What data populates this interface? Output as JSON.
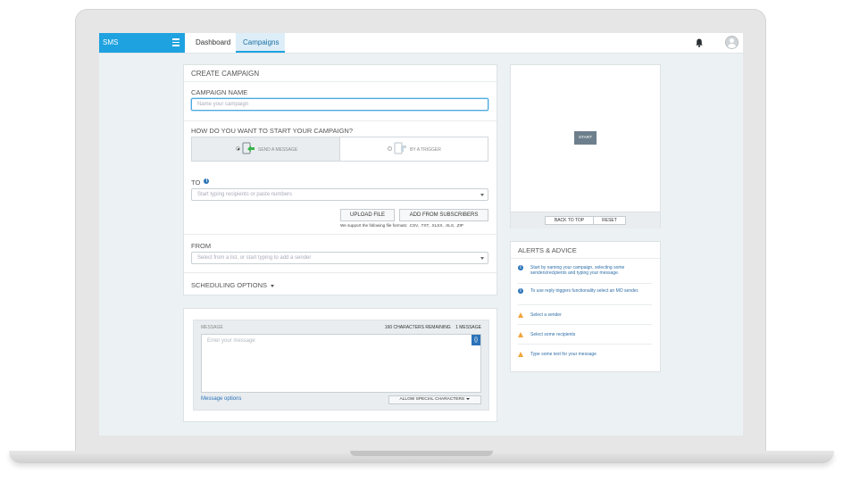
{
  "nav": {
    "brand": "SMS",
    "tabs": [
      {
        "label": "Dashboard",
        "active": false
      },
      {
        "label": "Campaigns",
        "active": true
      }
    ]
  },
  "create": {
    "header": "CREATE CAMPAIGN",
    "name_label": "CAMPAIGN NAME",
    "name_placeholder": "Name your campaign",
    "start_question": "HOW DO YOU WANT TO START YOUR CAMPAIGN?",
    "option_message": "SEND A MESSAGE",
    "option_trigger": "BY A TRIGGER",
    "to_label": "TO",
    "to_placeholder": "Start typing recipients or paste numbers",
    "upload_button": "UPLOAD FILE",
    "add_subscribers_button": "ADD FROM SUBSCRIBERS",
    "formats_note": "We support the following file formats: .CSV, .TXT, .XLSX, .XLS, .ZIP",
    "from_label": "FROM",
    "from_placeholder": "Select from a list, or start typing to add a sender",
    "scheduling": "SCHEDULING OPTIONS"
  },
  "message": {
    "label": "MESSAGE",
    "remaining": "160 CHARACTERS REMAINING",
    "count": "1 MESSAGE",
    "placeholder": "Enter your message",
    "insert_button": "{}",
    "options_link": "Message options",
    "special_chars_button": "ALLOW SPECIAL CHARACTERS"
  },
  "flow": {
    "start_node": "START",
    "back_to_top": "BACK TO TOP",
    "reset": "RESET"
  },
  "alerts": {
    "header": "ALERTS & ADVICE",
    "items": [
      {
        "type": "info",
        "text": "Start by naming your campaign, selecting some senders/recipients and typing your message."
      },
      {
        "type": "info",
        "text": "To use reply triggers functionality select an MO sender."
      },
      {
        "type": "warning",
        "text": "Select a sender"
      },
      {
        "type": "warning",
        "text": "Select some recipients"
      },
      {
        "type": "warning",
        "text": "Type some text for your message"
      }
    ]
  },
  "colors": {
    "brand": "#1fa2e0",
    "info": "#2b73b8",
    "warning": "#f0a63b",
    "start_node": "#6d7f8c"
  }
}
